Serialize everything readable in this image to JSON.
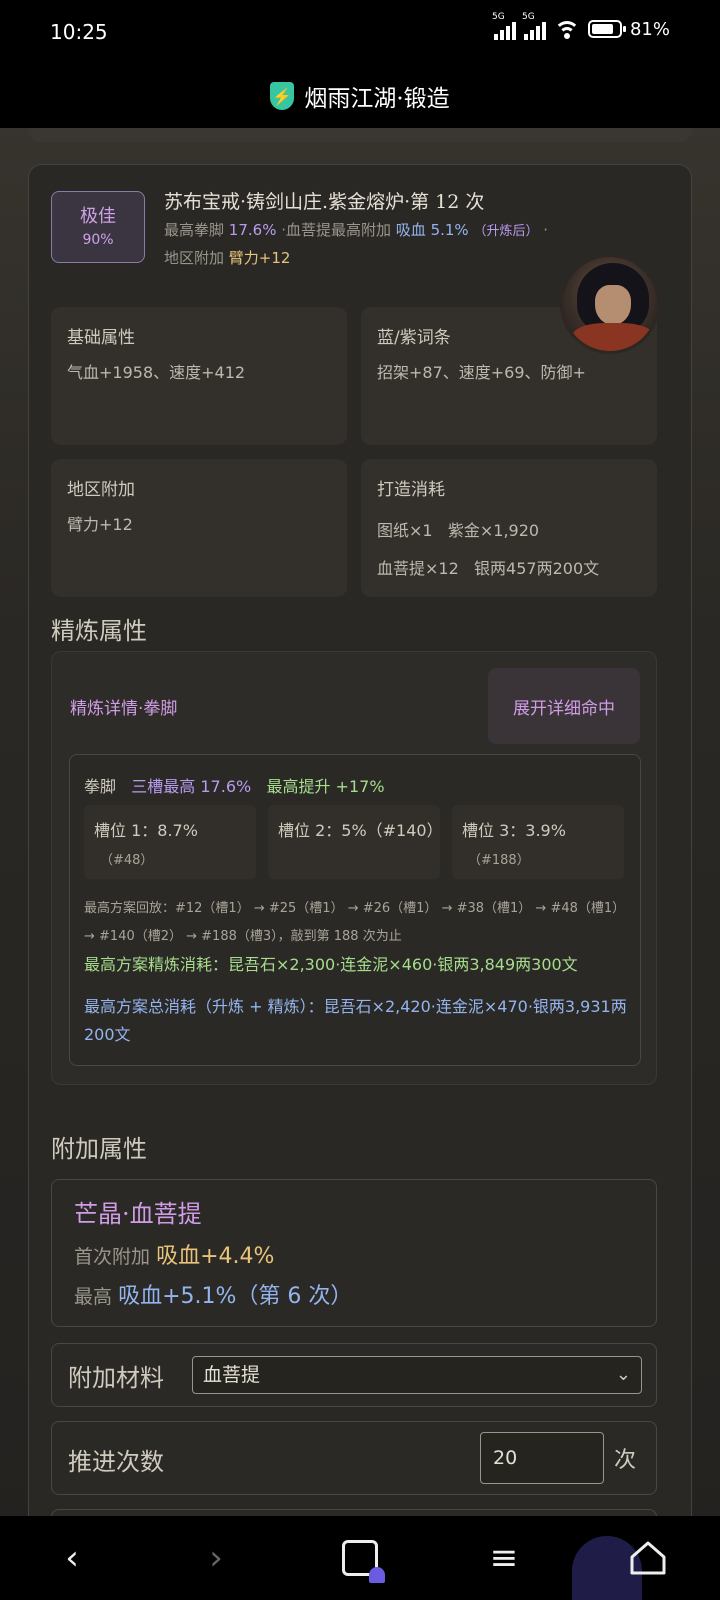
{
  "status": {
    "time": "10:25",
    "signal1": "5G",
    "signal2": "5G",
    "battery": "81%",
    "battery_level": 0.81
  },
  "app": {
    "title": "烟雨江湖·锻造"
  },
  "header": {
    "rank_label": "极佳",
    "rank_percent": "90%",
    "title": "苏布宝戒·铸剑山庄.紫金熔炉·第 12 次",
    "sub_prefix": "最高拳脚",
    "sub_value": "17.6%",
    "sub_mid": "·血菩提最高附加",
    "sub_blood": "吸血 5.1%",
    "sub_note": "（升炼后）",
    "sub_dot": "·",
    "region_prefix": "地区附加",
    "region_value": "臂力+12"
  },
  "stats": {
    "base_label": "基础属性",
    "base_value": "气血+1958、速度+412",
    "affix_label": "蓝/紫词条",
    "affix_value": "招架+87、速度+69、防御+",
    "region_label": "地区附加",
    "region_value": "臂力+12",
    "cost_label": "打造消耗",
    "cost_line1a": "图纸×1",
    "cost_line1b": "紫金×1,920",
    "cost_line2a": "血菩提×12",
    "cost_line2b": "银两457两200文"
  },
  "refine": {
    "section_title": "精炼属性",
    "head": "精炼详情·拳脚",
    "expand_button": "展开详细命中",
    "row_label": "拳脚",
    "row_max": "三槽最高 17.6%",
    "row_boost": "最高提升 +17%",
    "slots": [
      {
        "title": "槽位 1：8.7%",
        "sub": "（#48）"
      },
      {
        "title": "槽位 2：5%（#140）",
        "sub": ""
      },
      {
        "title": "槽位 3：3.9%",
        "sub": "（#188）"
      }
    ],
    "replay": "最高方案回放：#12（槽1） → #25（槽1） → #26（槽1） → #38（槽1） → #48（槽1） → #140（槽2） → #188（槽3），敲到第 188 次为止",
    "cost_refine": "最高方案精炼消耗：昆吾石×2,300·连金泥×460·银两3,849两300文",
    "cost_total": "最高方案总消耗（升炼 + 精炼）：昆吾石×2,420·连金泥×470·银两3,931两200文"
  },
  "extra": {
    "section_title": "附加属性",
    "name": "芒晶·血菩提",
    "first_prefix": "首次附加",
    "first_value": "吸血+4.4%",
    "max_prefix": "最高",
    "max_value": "吸血+5.1%（第 6 次）"
  },
  "form": {
    "material_label": "附加材料",
    "material_value": "血菩提",
    "count_label": "推进次数",
    "count_value": "20",
    "count_unit": "次"
  },
  "nav": {
    "back": "‹",
    "forward": "›",
    "menu": "≡"
  }
}
